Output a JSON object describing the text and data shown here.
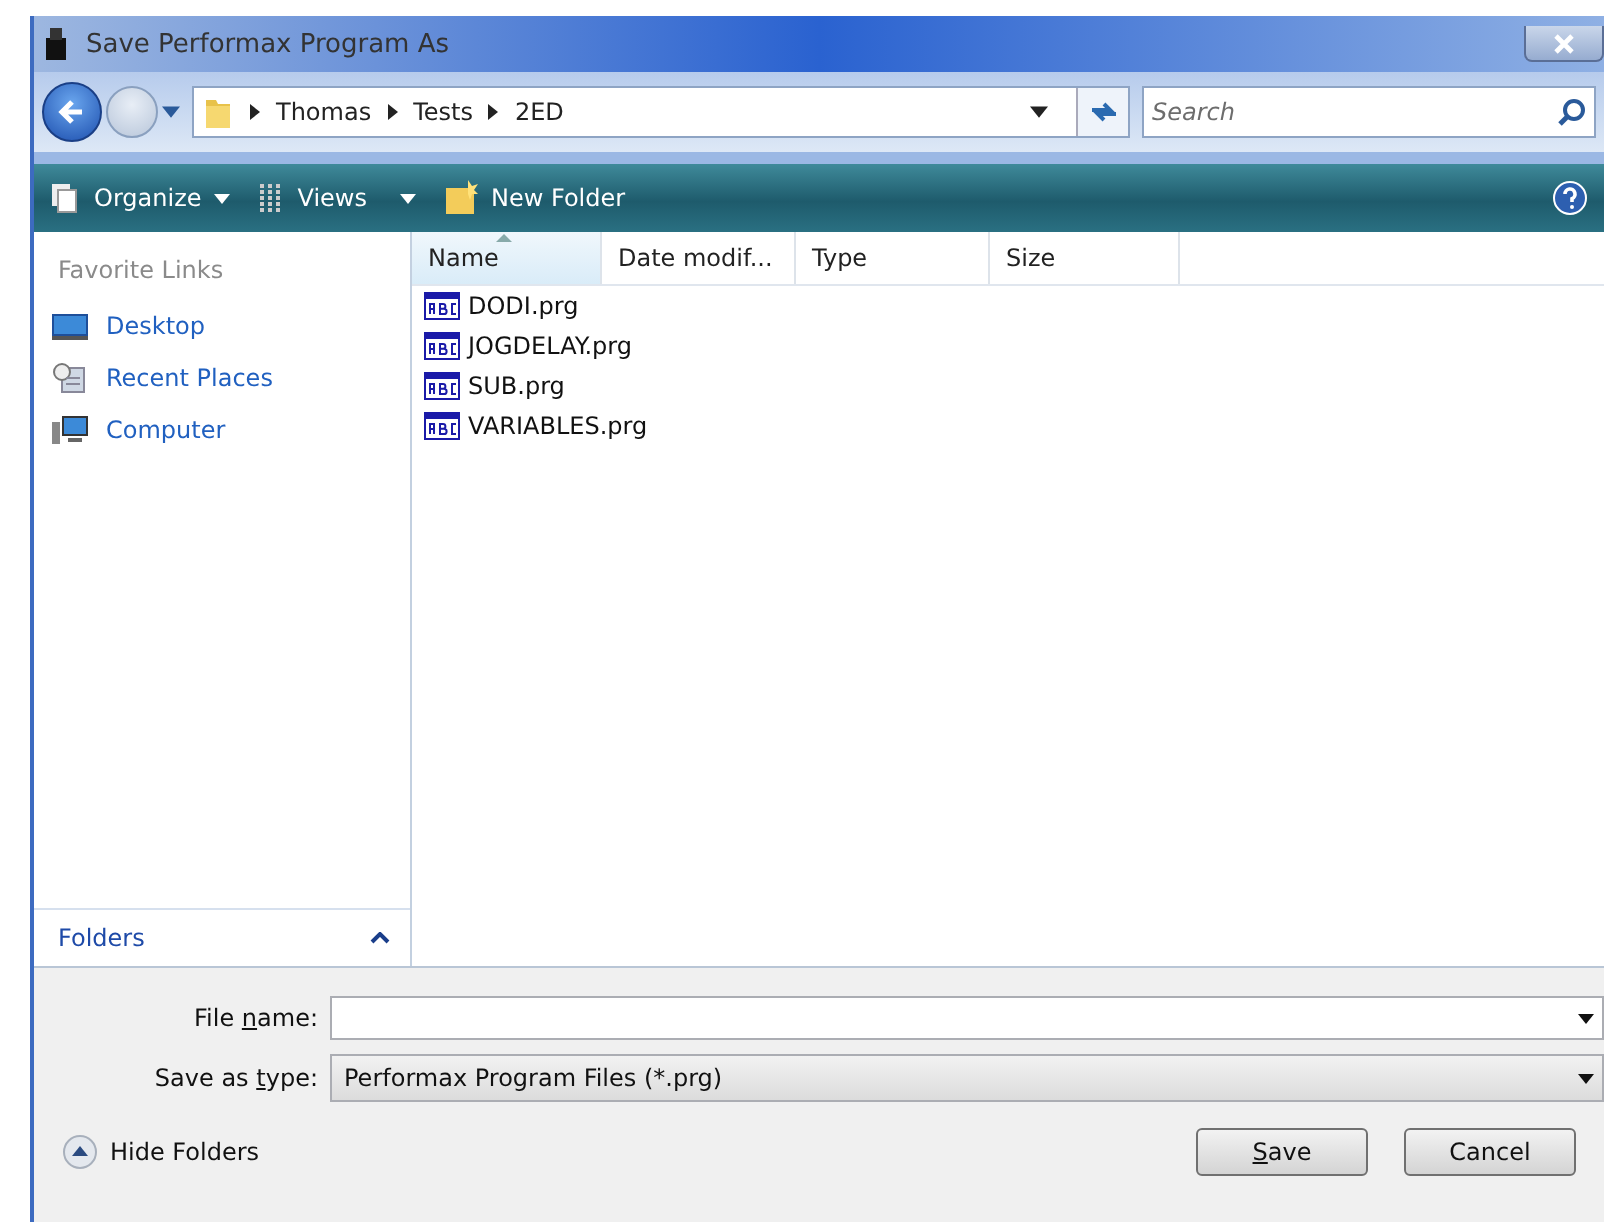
{
  "window": {
    "title": "Save Performax Program As"
  },
  "address": {
    "path": [
      "Thomas",
      "Tests",
      "2ED"
    ]
  },
  "search": {
    "placeholder": "Search"
  },
  "toolbar": {
    "items": [
      "Organize",
      "Views",
      "New Folder"
    ]
  },
  "sidebar": {
    "heading": "Favorite Links",
    "items": [
      {
        "label": "Desktop"
      },
      {
        "label": "Recent Places"
      },
      {
        "label": "Computer"
      }
    ],
    "folders_label": "Folders"
  },
  "table": {
    "columns": [
      {
        "label": "Name",
        "sorted": true
      },
      {
        "label": "Date modif...",
        "sorted": false
      },
      {
        "label": "Type",
        "sorted": false
      },
      {
        "label": "Size",
        "sorted": false
      }
    ],
    "rows": [
      "DODI.prg",
      "JOGDELAY.prg",
      "SUB.prg",
      "VARIABLES.prg"
    ]
  },
  "form": {
    "file_name_label": [
      "File ",
      "n",
      "ame:"
    ],
    "type_label": [
      "Save as ",
      "t",
      "ype:"
    ],
    "type_value": "Performax Program Files (*.prg)"
  },
  "hide_folders": "Hide Folders",
  "buttons": [
    {
      "mnemonic": "S",
      "rest": "ave"
    },
    {
      "label": "Cancel"
    }
  ]
}
